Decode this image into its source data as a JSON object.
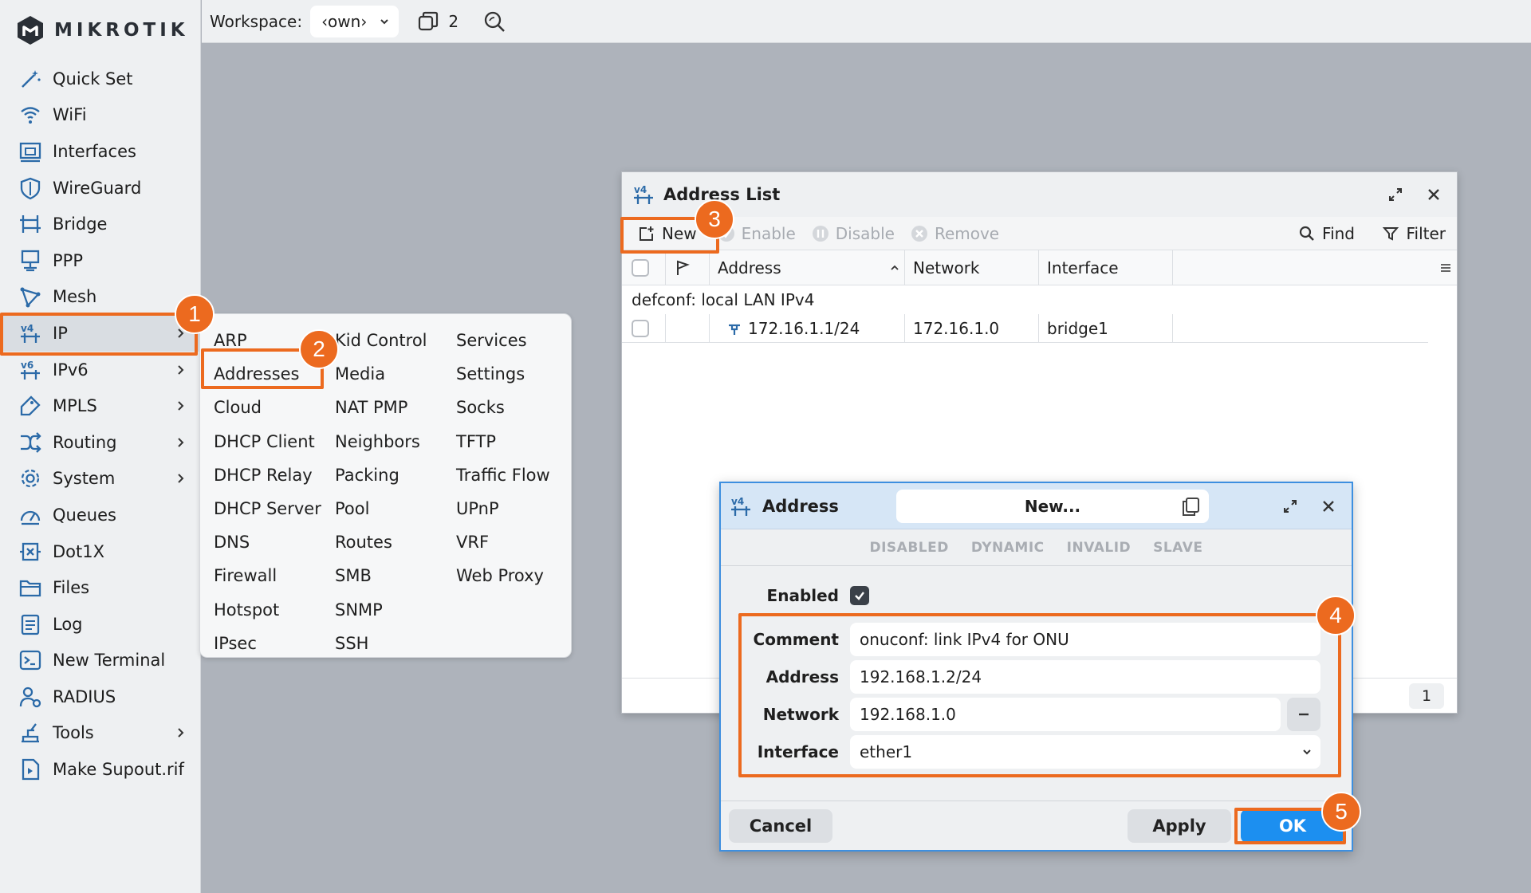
{
  "brand": {
    "logo_text": "MIKROTIK",
    "accent": "#1c8ff0",
    "highlight": "#ec6a1f"
  },
  "topbar": {
    "workspace_label": "Workspace:",
    "workspace_value": "‹own›",
    "windows_count": "2"
  },
  "sidebar": {
    "items": [
      {
        "label": "Quick Set",
        "icon": "magic-wand-icon"
      },
      {
        "label": "WiFi",
        "icon": "wifi-icon"
      },
      {
        "label": "Interfaces",
        "icon": "ethernet-port-icon"
      },
      {
        "label": "WireGuard",
        "icon": "shield-icon"
      },
      {
        "label": "Bridge",
        "icon": "bridge-icon"
      },
      {
        "label": "PPP",
        "icon": "ppp-icon"
      },
      {
        "label": "Mesh",
        "icon": "mesh-icon"
      },
      {
        "label": "IP",
        "icon": "ipv4-icon",
        "submenu": true
      },
      {
        "label": "IPv6",
        "icon": "ipv6-icon",
        "submenu": true
      },
      {
        "label": "MPLS",
        "icon": "tag-icon",
        "submenu": true
      },
      {
        "label": "Routing",
        "icon": "routing-icon",
        "submenu": true
      },
      {
        "label": "System",
        "icon": "gear-icon",
        "submenu": true
      },
      {
        "label": "Queues",
        "icon": "gauge-icon"
      },
      {
        "label": "Dot1X",
        "icon": "dot1x-icon"
      },
      {
        "label": "Files",
        "icon": "folder-icon"
      },
      {
        "label": "Log",
        "icon": "log-icon"
      },
      {
        "label": "New Terminal",
        "icon": "terminal-icon"
      },
      {
        "label": "RADIUS",
        "icon": "radius-icon"
      },
      {
        "label": "Tools",
        "icon": "tools-icon",
        "submenu": true
      },
      {
        "label": "Make Supout.rif",
        "icon": "file-icon"
      }
    ]
  },
  "ip_menu": {
    "col1": [
      "ARP",
      "Addresses",
      "Cloud",
      "DHCP Client",
      "DHCP Relay",
      "DHCP Server",
      "DNS",
      "Firewall",
      "Hotspot",
      "IPsec"
    ],
    "col2": [
      "Kid Control",
      "Media",
      "NAT PMP",
      "Neighbors",
      "Packing",
      "Pool",
      "Routes",
      "SMB",
      "SNMP",
      "SSH"
    ],
    "col3": [
      "Services",
      "Settings",
      "Socks",
      "TFTP",
      "Traffic Flow",
      "UPnP",
      "VRF",
      "Web Proxy"
    ]
  },
  "address_list": {
    "title": "Address List",
    "toolbar": {
      "new": "New",
      "enable": "Enable",
      "disable": "Disable",
      "remove": "Remove",
      "find": "Find",
      "filter": "Filter"
    },
    "columns": [
      "Address",
      "Network",
      "Interface"
    ],
    "group_label": "defconf: local LAN IPv4",
    "rows": [
      {
        "address": "172.16.1.1/24",
        "network": "172.16.1.0",
        "interface": "bridge1"
      }
    ],
    "count": "1"
  },
  "dialog": {
    "title": "Address",
    "name_value": "New...",
    "flags": [
      "DISABLED",
      "DYNAMIC",
      "INVALID",
      "SLAVE"
    ],
    "fields": {
      "enabled_label": "Enabled",
      "comment_label": "Comment",
      "comment_value": "onuconf: link IPv4 for ONU",
      "address_label": "Address",
      "address_value": "192.168.1.2/24",
      "network_label": "Network",
      "network_value": "192.168.1.0",
      "interface_label": "Interface",
      "interface_value": "ether1"
    },
    "buttons": {
      "cancel": "Cancel",
      "apply": "Apply",
      "ok": "OK"
    }
  },
  "steps": [
    "1",
    "2",
    "3",
    "4",
    "5"
  ]
}
